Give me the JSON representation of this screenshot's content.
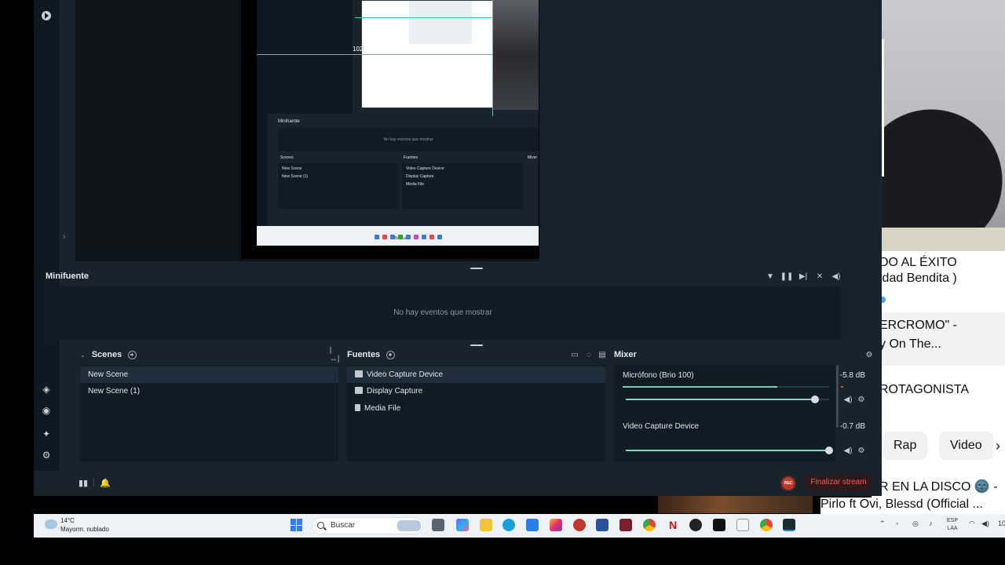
{
  "obs": {
    "nested_preview": {
      "px_label": "1029 px",
      "mini_title": "Minifuente",
      "mini_empty": "No hay eventos que mostrar",
      "scenes_title": "Scenes",
      "sources_title": "Fuentes",
      "mixer_title": "Mixer",
      "scene_1": "New Scene",
      "scene_2": "New Scene (1)",
      "source_1": "Video Capture Device",
      "source_2": "Display Capture",
      "source_3": "Media File",
      "search_label": "Buscar"
    },
    "minifuente": {
      "title": "Minifuente",
      "empty_message": "No hay eventos que mostrar"
    },
    "scenes": {
      "title": "Scenes",
      "items": [
        {
          "label": "New Scene",
          "selected": true
        },
        {
          "label": "New Scene (1)",
          "selected": false
        }
      ]
    },
    "sources": {
      "title": "Fuentes",
      "items": [
        {
          "label": "Video Capture Device",
          "icon": "camera-icon",
          "selected": true
        },
        {
          "label": "Display Capture",
          "icon": "monitor-icon",
          "selected": false
        },
        {
          "label": "Media File",
          "icon": "file-icon",
          "selected": false
        }
      ]
    },
    "mixer": {
      "title": "Mixer",
      "channels": [
        {
          "name": "Micrófono (Brio 100)",
          "db": "-5.8 dB",
          "level": 0.75,
          "volume": 0.93
        },
        {
          "name": "Video Capture Device",
          "db": "-0.7 dB",
          "level": 0.0,
          "volume": 1.0
        }
      ]
    },
    "footer": {
      "rec_label": "REC",
      "end_stream_label": "Finalizar stream"
    },
    "colors": {
      "accent": "#7bdcbd",
      "end_stream": "#ff5a5a",
      "panel": "#0f1c24",
      "background": "#17242d"
    }
  },
  "youtube": {
    "line1": "DO AL ÉXITO",
    "line2": "idad Bendita )",
    "line3": "ERCROMO\" -",
    "line4": "y On The...",
    "line5": "ROTAGONISTA",
    "chip_1": "Rap",
    "chip_2": "Video",
    "line6": "R EN LA DISCO 🌚 -",
    "line7": "Pirlo ft Ovi, Blessd (Official ..."
  },
  "taskbar": {
    "weather_temp": "14°C",
    "weather_cond": "Mayorm. nublado",
    "search_placeholder": "Buscar",
    "lang_line1": "ESP",
    "lang_line2": "LAA",
    "tray_partial": "10"
  }
}
